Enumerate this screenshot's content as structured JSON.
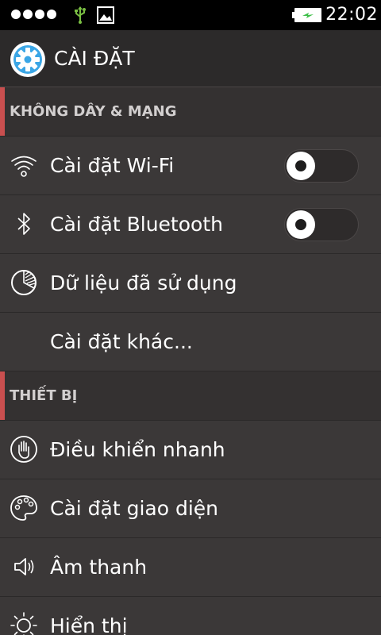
{
  "status_bar": {
    "time": "22:02",
    "signal_icon": "signal-dots-icon",
    "usb_icon": "usb-icon",
    "notification_icon": "image-icon",
    "battery_icon": "battery-charging-icon"
  },
  "app_bar": {
    "title": "CÀI ĐẶT",
    "logo_icon": "settings-gear-icon"
  },
  "sections": {
    "wireless": {
      "title": "KHÔNG DÂY & MẠNG"
    },
    "device": {
      "title": "THIẾT BỊ"
    }
  },
  "items": {
    "wifi": {
      "label": "Cài đặt Wi-Fi",
      "icon": "wifi-icon",
      "enabled": false
    },
    "bluetooth": {
      "label": "Cài đặt Bluetooth",
      "icon": "bluetooth-icon",
      "enabled": false
    },
    "data_usage": {
      "label": "Dữ liệu đã sử dụng",
      "icon": "data-usage-icon"
    },
    "more": {
      "label": "Cài đặt khác..."
    },
    "quick_control": {
      "label": "Điều khiển nhanh",
      "icon": "hand-icon"
    },
    "theme": {
      "label": "Cài đặt giao diện",
      "icon": "palette-icon"
    },
    "sound": {
      "label": "Âm thanh",
      "icon": "speaker-icon"
    },
    "display": {
      "label": "Hiển thị",
      "icon": "brightness-icon"
    }
  },
  "colors": {
    "accent": "#c94f4f",
    "background": "#3b3838",
    "header": "#2c2a2a",
    "logo": "#3aa6e6",
    "usb": "#7bc043",
    "battery_charge": "#3fbf4a"
  }
}
